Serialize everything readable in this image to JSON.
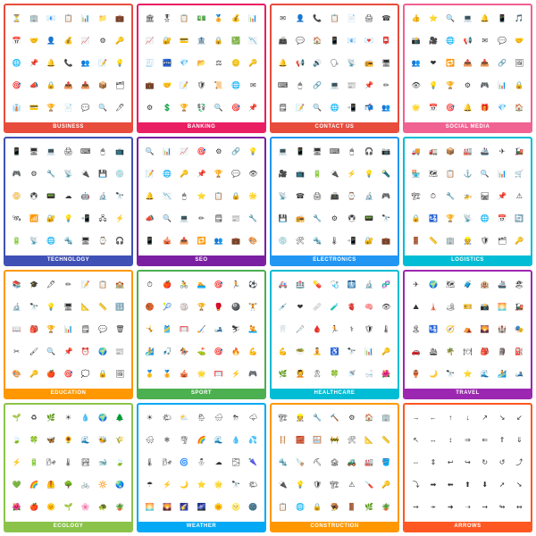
{
  "cards": [
    {
      "id": "business",
      "label": "BUSINESS",
      "colorClass": "card-business",
      "icons": [
        "⏳",
        "🏢",
        "📧",
        "📋",
        "📊",
        "📁",
        "💼",
        "📅",
        "🤝",
        "👤",
        "💰",
        "📈",
        "⚙",
        "🔑",
        "🌐",
        "📌",
        "🔔",
        "📞",
        "👥",
        "📝",
        "💡",
        "🎯",
        "📣",
        "🔒",
        "📤",
        "📥",
        "📦",
        "🗂",
        "👔",
        "💳",
        "🏆",
        "📄",
        "💬",
        "🔍",
        "🖊"
      ]
    },
    {
      "id": "banking",
      "label": "BANKING",
      "colorClass": "card-banking",
      "icons": [
        "🏛",
        "🎖",
        "📋",
        "💵",
        "🏅",
        "💰",
        "📊",
        "📈",
        "🔐",
        "💳",
        "🏦",
        "🔒",
        "💹",
        "📉",
        "🧾",
        "🏧",
        "💎",
        "📂",
        "⚖",
        "🪙",
        "🔑",
        "💼",
        "🤝",
        "📝",
        "🛡",
        "📜",
        "🌐",
        "✉",
        "⚙",
        "💲",
        "🏆",
        "💱",
        "🔍",
        "🎯",
        "📌"
      ]
    },
    {
      "id": "contact",
      "label": "CONTACT US",
      "colorClass": "card-contact",
      "icons": [
        "✉",
        "👤",
        "📞",
        "📋",
        "📄",
        "🖨",
        "☎",
        "📠",
        "💬",
        "🏠",
        "📱",
        "📧",
        "💌",
        "📮",
        "🔔",
        "📢",
        "🔊",
        "🗣",
        "📡",
        "📻",
        "🖥",
        "⌨",
        "🖱",
        "🔗",
        "💻",
        "📰",
        "📌",
        "✏",
        "🗒",
        "📝",
        "🔍",
        "🌐",
        "📲",
        "📬",
        "👥"
      ]
    },
    {
      "id": "social",
      "label": "SOCIAL MEDIA",
      "colorClass": "card-social",
      "icons": [
        "👍",
        "⭐",
        "🔍",
        "💻",
        "🔔",
        "📱",
        "🎵",
        "📸",
        "🎥",
        "🌐",
        "📢",
        "✉",
        "💬",
        "🤝",
        "👥",
        "❤",
        "🔁",
        "📤",
        "📥",
        "🔗",
        "🖼",
        "👁",
        "💡",
        "🏆",
        "⚙",
        "🎮",
        "📊",
        "🔒",
        "🌟",
        "📅",
        "🎯",
        "🔔",
        "🎁",
        "💎",
        "🏠"
      ]
    },
    {
      "id": "technology",
      "label": "TECHNOLOGY",
      "colorClass": "card-technology",
      "icons": [
        "📱",
        "🖥",
        "💻",
        "🖨",
        "⌨",
        "🖱",
        "📺",
        "🎮",
        "⚙",
        "🔧",
        "📡",
        "🔌",
        "💾",
        "💿",
        "📀",
        "🖲",
        "📟",
        "☁",
        "🤖",
        "🔬",
        "🔭",
        "🛰",
        "📶",
        "🔐",
        "💡",
        "📲",
        "🖧",
        "⚡",
        "🔋",
        "📡",
        "🌐",
        "🔩",
        "🖥",
        "⌚",
        "🎧"
      ]
    },
    {
      "id": "seo",
      "label": "SEO",
      "colorClass": "card-seo",
      "icons": [
        "🔍",
        "📊",
        "📈",
        "🎯",
        "⚙",
        "🔗",
        "💡",
        "📝",
        "🌐",
        "🔑",
        "📌",
        "🏆",
        "💬",
        "👁",
        "🔔",
        "📉",
        "🖱",
        "⭐",
        "📋",
        "🔒",
        "🌟",
        "📣",
        "🔍",
        "💻",
        "✏",
        "🗒",
        "📰",
        "🔧",
        "📱",
        "🎪",
        "📤",
        "🔁",
        "👥",
        "💼",
        "🎨"
      ]
    },
    {
      "id": "electronics",
      "label": "ELECTRONICS",
      "colorClass": "card-electronics",
      "icons": [
        "💻",
        "📱",
        "🖥",
        "⌨",
        "🖱",
        "🎧",
        "📷",
        "🎥",
        "📺",
        "🔋",
        "🔌",
        "⚡",
        "💡",
        "🔦",
        "📡",
        "☎",
        "🖨",
        "📠",
        "⌚",
        "🔬",
        "🎮",
        "💾",
        "📻",
        "🔧",
        "⚙",
        "🖲",
        "📟",
        "🔭",
        "💿",
        "🛠",
        "🔩",
        "🌡",
        "📲",
        "🔐",
        "💼"
      ]
    },
    {
      "id": "logistics",
      "label": "LOGISTICS",
      "colorClass": "card-logistics",
      "icons": [
        "🚚",
        "🚛",
        "📦",
        "🏭",
        "🚢",
        "✈",
        "🚂",
        "🏪",
        "🗺",
        "📋",
        "⚓",
        "🔍",
        "📊",
        "🛒",
        "🏗",
        "⏱",
        "🔧",
        "🚁",
        "🛤",
        "📌",
        "⚠",
        "🔒",
        "🛂",
        "🏆",
        "📡",
        "🌐",
        "📅",
        "🔄",
        "🚪",
        "📏",
        "🏢",
        "👷",
        "🛡",
        "🗂",
        "🔑"
      ]
    },
    {
      "id": "education",
      "label": "EDUCATION",
      "colorClass": "card-education",
      "icons": [
        "📚",
        "🎓",
        "🖊",
        "✏",
        "📝",
        "📋",
        "🏫",
        "🔬",
        "🔭",
        "💡",
        "🖥",
        "📐",
        "📏",
        "🔢",
        "📖",
        "🎒",
        "🏆",
        "📊",
        "🗒",
        "💬",
        "🗑",
        "✂",
        "🖌",
        "🔍",
        "📌",
        "⏰",
        "🌍",
        "📰",
        "🎨",
        "🔑",
        "🍎",
        "🎯",
        "💭",
        "🔒",
        "🖼"
      ]
    },
    {
      "id": "sport",
      "label": "SPORT",
      "colorClass": "card-sport",
      "icons": [
        "⏱",
        "🍎",
        "🚴",
        "🏊",
        "🎯",
        "🏃",
        "⚽",
        "🏀",
        "🎾",
        "🏐",
        "🏆",
        "🥊",
        "🎱",
        "🏋",
        "🤸",
        "🎽",
        "🥅",
        "🏑",
        "🎿",
        "⛷",
        "🤽",
        "🏄",
        "🎣",
        "🏇",
        "⛳",
        "🎯",
        "🔥",
        "💪",
        "🥇",
        "🏅",
        "🎪",
        "🌟",
        "🥅",
        "⚡",
        "🎮"
      ]
    },
    {
      "id": "healthcare",
      "label": "HEALTHCARE",
      "colorClass": "card-healthcare",
      "icons": [
        "🚑",
        "🏥",
        "💊",
        "🩺",
        "🩻",
        "🔬",
        "🧬",
        "💉",
        "❤",
        "🩹",
        "🧪",
        "🫀",
        "🧠",
        "👁",
        "🦷",
        "🩼",
        "🩸",
        "🏃",
        "⚕",
        "🛡",
        "🌡",
        "💪",
        "🥗",
        "🧘",
        "♿",
        "🔭",
        "📊",
        "🔑",
        "🌿",
        "💆",
        "🎗",
        "🍀",
        "🚿",
        "🛁",
        "🌺"
      ]
    },
    {
      "id": "travel",
      "label": "TRAVEL",
      "colorClass": "card-travel",
      "icons": [
        "✈",
        "🌍",
        "🗺",
        "🧳",
        "🏨",
        "🚢",
        "🏖",
        "⛰",
        "🗼",
        "🏕",
        "🎫",
        "📸",
        "🌅",
        "🚂",
        "🏝",
        "🛂",
        "🧭",
        "⛺",
        "🌄",
        "🏰",
        "🎭",
        "🚗",
        "🛳",
        "🌴",
        "🍽",
        "🎒",
        "🗿",
        "⛽",
        "🏺",
        "🌙",
        "🔭",
        "⭐",
        "🌊",
        "🏄",
        "🎿"
      ]
    },
    {
      "id": "ecology",
      "label": "ECOLOGY",
      "colorClass": "card-ecology",
      "icons": [
        "🌱",
        "♻",
        "🌿",
        "☀",
        "💧",
        "🌍",
        "🌲",
        "🍃",
        "🍀",
        "🦋",
        "🌻",
        "🌊",
        "🐝",
        "🌾",
        "⚡",
        "🔋",
        "🌬",
        "🌡",
        "🏞",
        "🐋",
        "🍃",
        "💚",
        "🌈",
        "🦺",
        "🌳",
        "🚲",
        "🔆",
        "🌏",
        "🌺",
        "🍎",
        "🌞",
        "🌱",
        "🌸",
        "🐢",
        "🪴"
      ]
    },
    {
      "id": "weather",
      "label": "WEATHER",
      "colorClass": "card-weather",
      "icons": [
        "☀",
        "🌤",
        "⛅",
        "🌦",
        "🌧",
        "⛈",
        "🌩",
        "🌨",
        "❄",
        "🌪",
        "🌈",
        "🌊",
        "💧",
        "💦",
        "🌡",
        "🌬",
        "🌀",
        "⛄",
        "☁",
        "🌫",
        "🌂",
        "☂",
        "⚡",
        "🌙",
        "⭐",
        "🌟",
        "🔭",
        "🌤",
        "🌅",
        "🌄",
        "🌠",
        "🌌",
        "🌞",
        "🌝",
        "🌚"
      ]
    },
    {
      "id": "construction",
      "label": "CONSTRUCTION",
      "colorClass": "card-construction",
      "icons": [
        "🏗",
        "👷",
        "🔧",
        "🔨",
        "⚙",
        "🏠",
        "🏢",
        "🪜",
        "🧱",
        "🪟",
        "🚧",
        "🛠",
        "📐",
        "📏",
        "🔩",
        "🪚",
        "⛏",
        "🏚",
        "🚜",
        "🏭",
        "🪣",
        "🔌",
        "💡",
        "🛡",
        "🏗",
        "⚠",
        "🪛",
        "🔑",
        "📋",
        "🌐",
        "🔒",
        "🪤",
        "🚪",
        "🌿",
        "🪴"
      ]
    },
    {
      "id": "arrows",
      "label": "ARROWS",
      "colorClass": "card-arrows",
      "icons": [
        "→",
        "←",
        "↑",
        "↓",
        "↗",
        "↘",
        "↙",
        "↖",
        "↔",
        "↕",
        "⇒",
        "⇐",
        "⇑",
        "⇓",
        "⇔",
        "⇕",
        "↩",
        "↪",
        "↻",
        "↺",
        "⤴",
        "⤵",
        "➡",
        "⬅",
        "⬆",
        "⬇",
        "➚",
        "➘",
        "➙",
        "➛",
        "➜",
        "➝",
        "➞",
        "↬",
        "↭"
      ]
    }
  ]
}
